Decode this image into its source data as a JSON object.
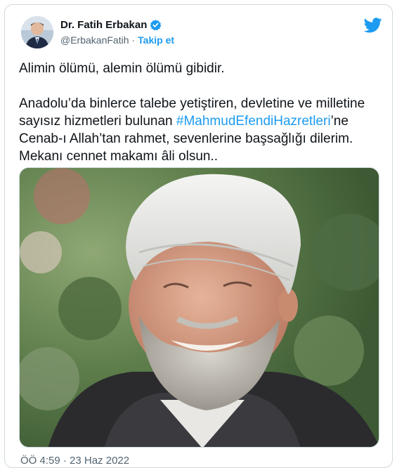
{
  "author": {
    "display_name": "Dr. Fatih Erbakan",
    "handle": "@ErbakanFatih",
    "separator": "·",
    "follow_label": "Takip et",
    "avatar_icon": "profile-photo",
    "verified_icon": "verified-badge-icon"
  },
  "brand": {
    "icon": "twitter-bird-icon",
    "color": "#1d9bf0"
  },
  "tweet": {
    "line1": "Alimin ölümü, alemin ölümü gibidir.",
    "line2_part1": "Anadolu’da binlerce talebe yetiştiren, devletine ve milletine sayısız hizmetleri bulunan ",
    "hashtag": "#MahmudEfendiHazretleri",
    "line2_part2": "’ne Cenab-ı Allah’tan rahmet, sevenlerine başsağlığı dilerim. Mekanı cennet makamı âli olsun..",
    "timestamp": "ÖÖ 4:59 · 23 Haz 2022"
  },
  "media": {
    "description_icon": "photo"
  },
  "colors": {
    "link": "#1d9bf0",
    "text": "#0f1419",
    "muted": "#536471",
    "border": "#cfd9de"
  }
}
